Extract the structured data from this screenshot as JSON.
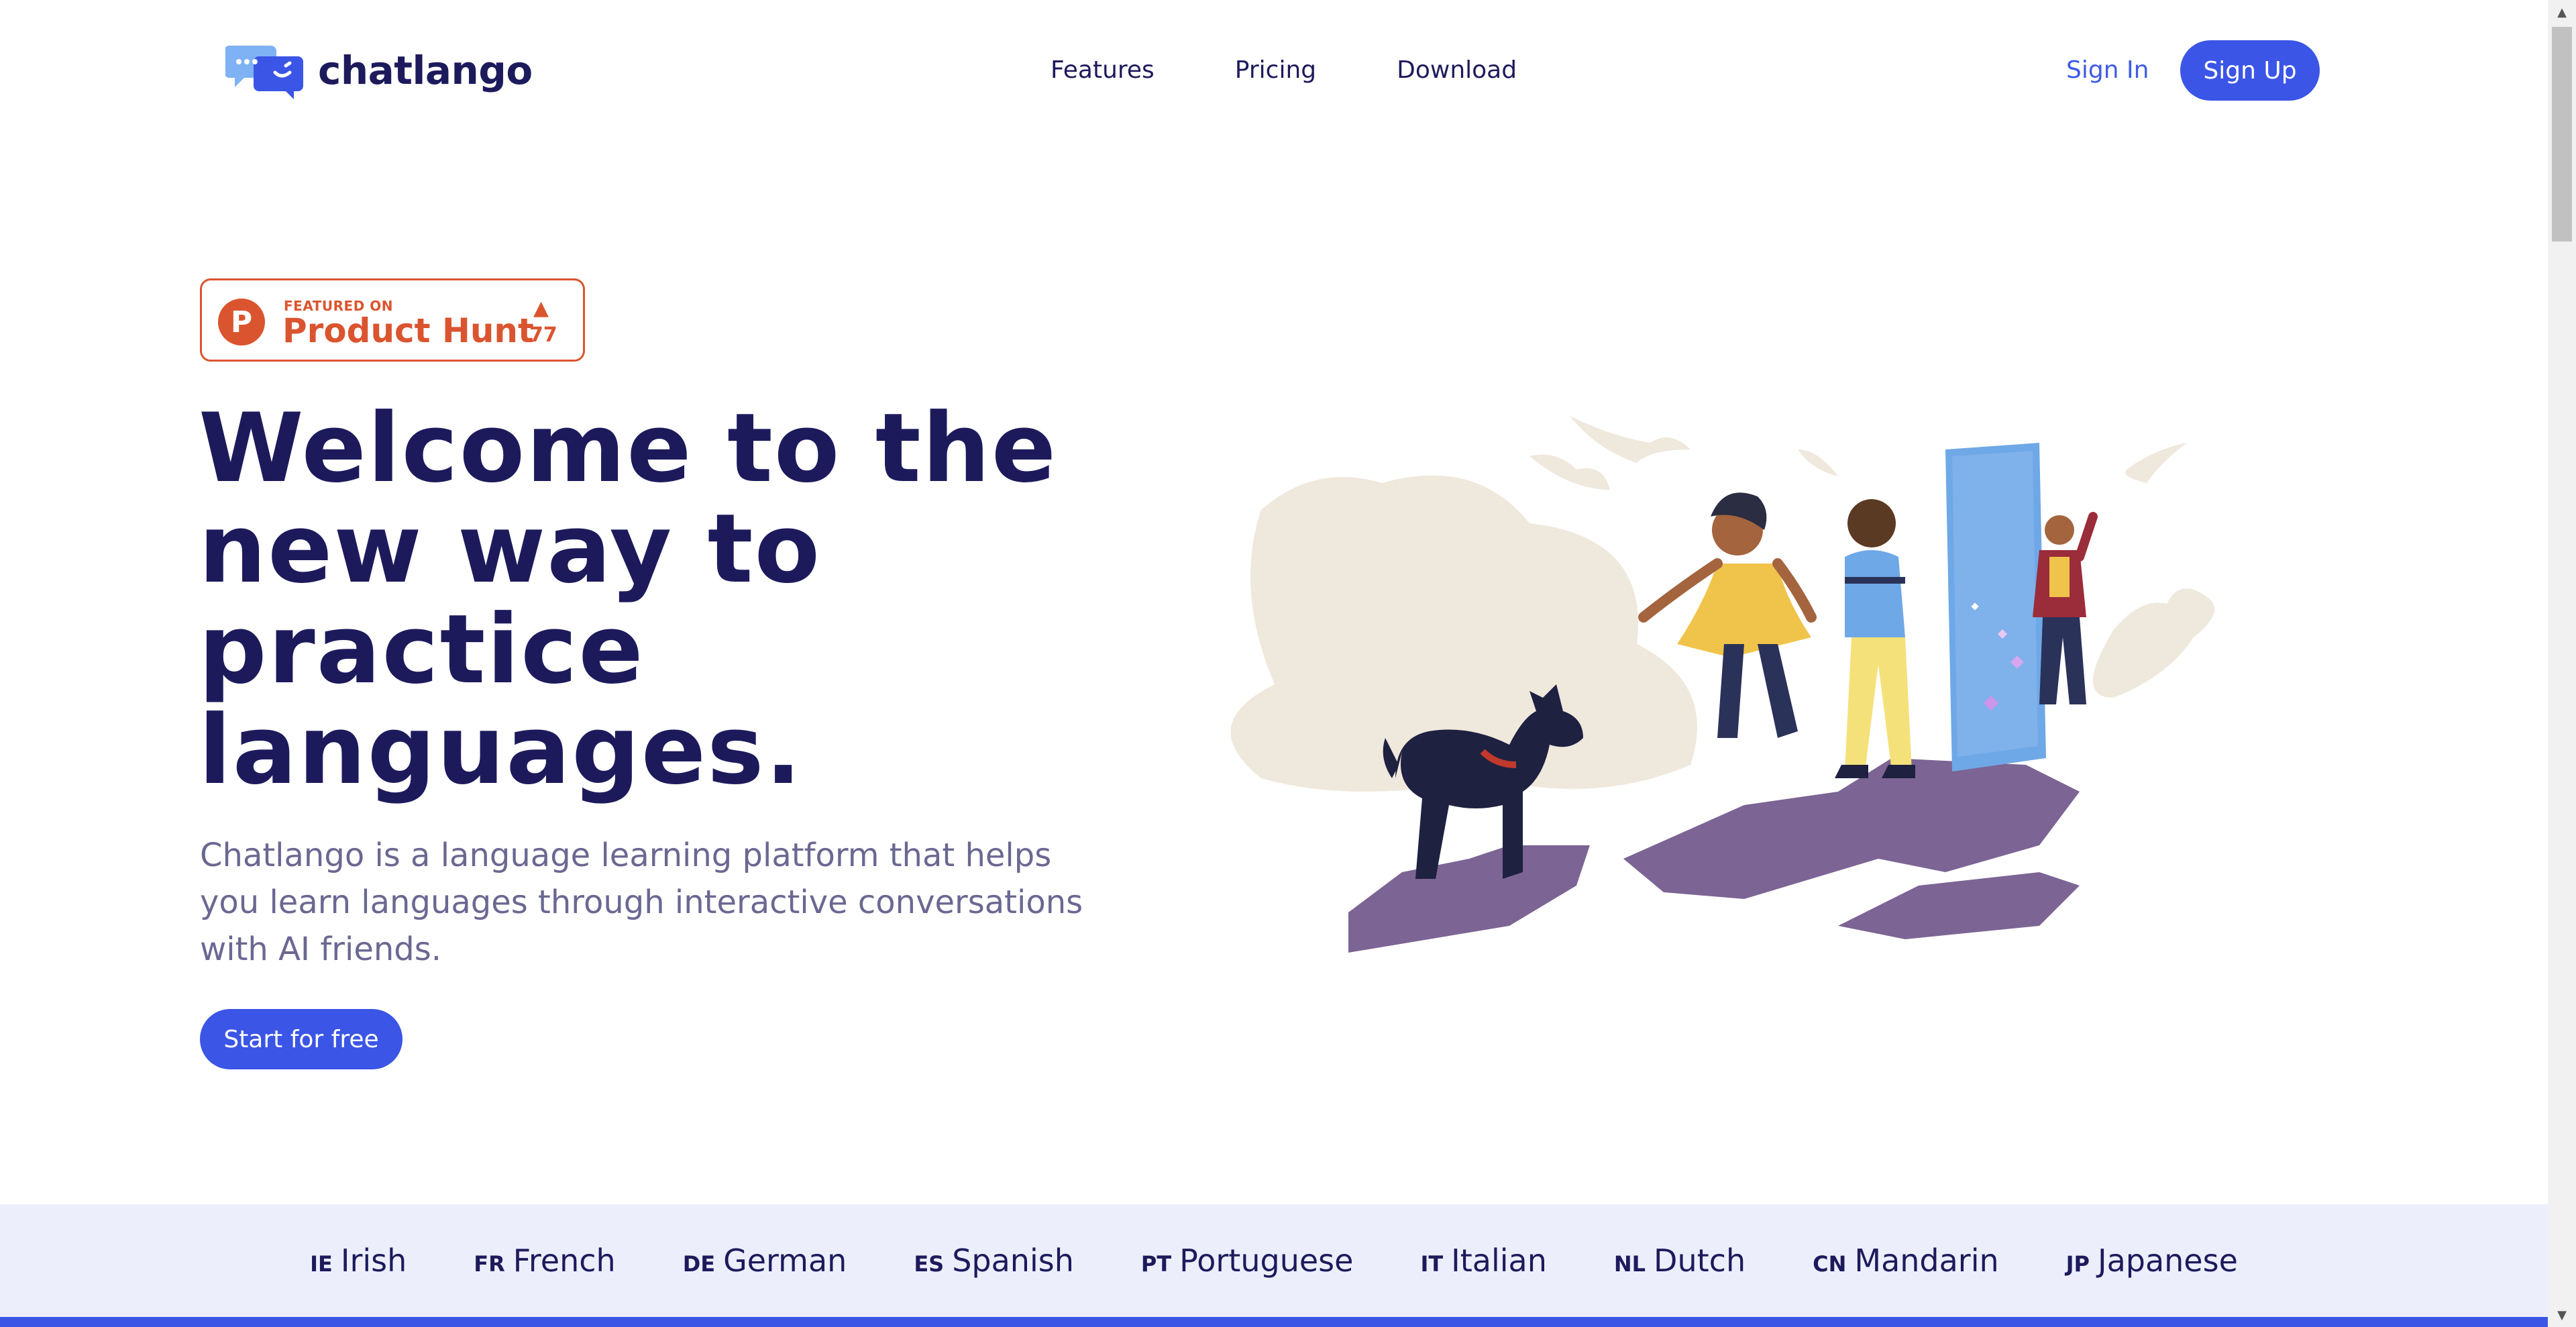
{
  "nav": {
    "brand": "chatlango",
    "links": [
      {
        "label": "Features"
      },
      {
        "label": "Pricing"
      },
      {
        "label": "Download"
      }
    ],
    "sign_in": "Sign In",
    "sign_up": "Sign Up"
  },
  "badge": {
    "small": "FEATURED ON",
    "big": "Product Hunt",
    "letter": "P",
    "arrow": "▲",
    "count": "77"
  },
  "hero": {
    "headline_lines": [
      "Welcome to the",
      "new way to",
      "practice",
      "languages."
    ],
    "subtitle": "Chatlango is a language learning platform that helps you learn languages through interactive conversations with AI friends.",
    "cta": "Start for free"
  },
  "languages": [
    {
      "code": "IE",
      "name": "Irish"
    },
    {
      "code": "FR",
      "name": "French"
    },
    {
      "code": "DE",
      "name": "German"
    },
    {
      "code": "ES",
      "name": "Spanish"
    },
    {
      "code": "PT",
      "name": "Portuguese"
    },
    {
      "code": "IT",
      "name": "Italian"
    },
    {
      "code": "NL",
      "name": "Dutch"
    },
    {
      "code": "CN",
      "name": "Mandarin"
    },
    {
      "code": "JP",
      "name": "Japanese"
    }
  ],
  "colors": {
    "primary": "#3b55e6",
    "heading": "#1d1a5c",
    "subtitle": "#6a6892",
    "producthunt": "#da552f",
    "strip_bg": "#eceffb"
  }
}
